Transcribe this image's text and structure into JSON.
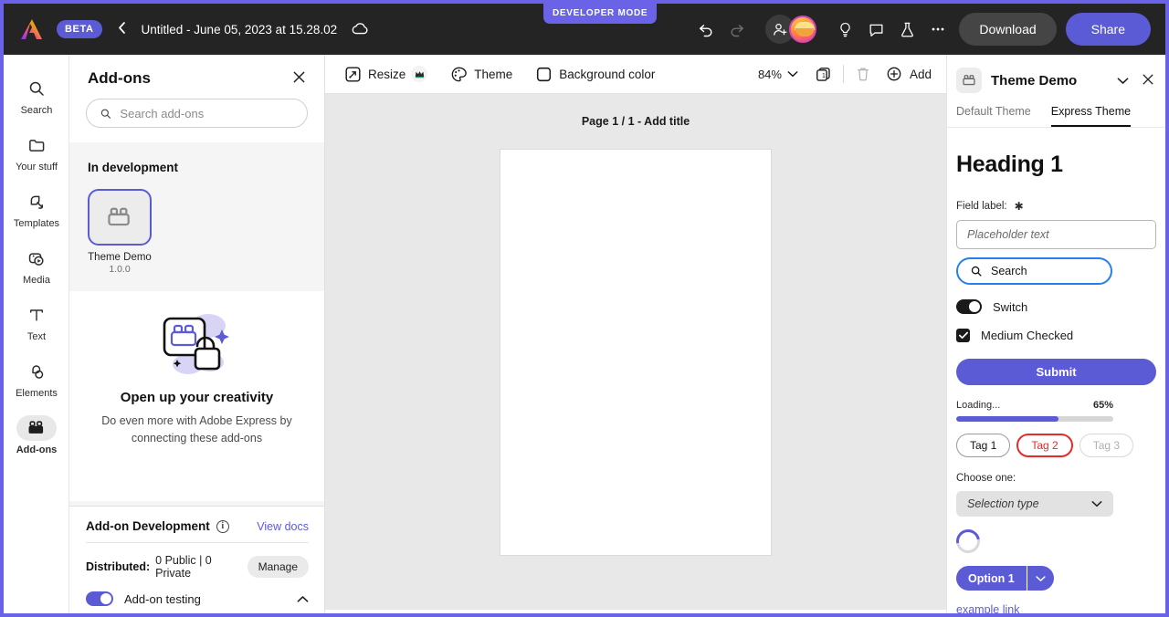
{
  "topbar": {
    "beta_badge": "BETA",
    "back_icon": "chevron-left-icon",
    "doc_title": "Untitled - June 05, 2023 at 15.28.02",
    "cloud_icon": "cloud-icon",
    "dev_mode_label": "DEVELOPER MODE",
    "undo_icon": "undo-icon",
    "redo_icon": "redo-icon",
    "invite_icon": "add-user-icon",
    "avatar_icon": "user-avatar",
    "ideas_icon": "lightbulb-icon",
    "comment_icon": "comment-icon",
    "experiments_icon": "flask-icon",
    "more_icon": "more-horizontal-icon",
    "download_label": "Download",
    "share_label": "Share"
  },
  "rail": {
    "items": [
      {
        "label": "Search",
        "icon": "search-icon",
        "active": false
      },
      {
        "label": "Your stuff",
        "icon": "folder-icon",
        "active": false
      },
      {
        "label": "Templates",
        "icon": "templates-icon",
        "active": false
      },
      {
        "label": "Media",
        "icon": "media-icon",
        "active": false
      },
      {
        "label": "Text",
        "icon": "text-icon",
        "active": false
      },
      {
        "label": "Elements",
        "icon": "elements-icon",
        "active": false
      },
      {
        "label": "Add-ons",
        "icon": "addons-icon",
        "active": true
      }
    ]
  },
  "panel": {
    "title": "Add-ons",
    "close_icon": "close-icon",
    "search_placeholder": "Search add-ons",
    "search_value": "",
    "search_icon": "search-icon",
    "in_development_title": "In development",
    "addon": {
      "name": "Theme Demo",
      "version": "1.0.0",
      "icon": "addons-icon"
    },
    "empty_state": {
      "illustration": "addon-unlock-illustration",
      "title": "Open up your creativity",
      "subtitle": "Do even more with Adobe Express by connecting these add-ons"
    },
    "development": {
      "heading": "Add-on Development",
      "info_icon": "info-icon",
      "view_docs": "View docs",
      "distributed_label": "Distributed:",
      "distributed_value": "0 Public | 0 Private",
      "manage_label": "Manage",
      "testing_label": "Add-on testing",
      "testing_on": true,
      "collapse_icon": "chevron-up-icon"
    }
  },
  "canvas": {
    "toolbar": {
      "resize_label": "Resize",
      "resize_icon": "resize-icon",
      "premium_icon": "crown-icon",
      "theme_label": "Theme",
      "theme_icon": "palette-icon",
      "background_label": "Background color",
      "background_icon": "square-icon",
      "zoom_value": "84%",
      "zoom_chevron": "chevron-down-icon",
      "pages_icon": "pages-icon",
      "delete_icon": "trash-icon",
      "add_label": "Add",
      "add_icon": "plus-circle-icon"
    },
    "page_label": "Page 1 / 1 - Add title"
  },
  "addon_panel": {
    "icon": "addons-icon",
    "title": "Theme Demo",
    "chevron_icon": "chevron-down-icon",
    "close_icon": "close-icon",
    "tabs": [
      {
        "label": "Default Theme",
        "active": false
      },
      {
        "label": "Express Theme",
        "active": true
      }
    ],
    "heading": "Heading 1",
    "field_label": "Field label:",
    "required_mark": "✱",
    "text_placeholder": "Placeholder text",
    "text_value": "",
    "search_label": "Search",
    "search_icon": "search-icon",
    "switch_label": "Switch",
    "switch_on": true,
    "checkbox_label": "Medium Checked",
    "checkbox_checked": true,
    "check_icon": "checkmark-icon",
    "submit_label": "Submit",
    "loading_label": "Loading...",
    "loading_percent": "65%",
    "progress_value": 65,
    "tags": [
      {
        "label": "Tag 1",
        "state": "default"
      },
      {
        "label": "Tag 2",
        "state": "error"
      },
      {
        "label": "Tag 3",
        "state": "disabled"
      }
    ],
    "choose_label": "Choose one:",
    "select_value": "Selection type",
    "select_chevron": "chevron-down-icon",
    "spinner_icon": "loading-spinner",
    "split_button_label": "Option 1",
    "split_button_chevron": "chevron-down-icon",
    "link_label": "example link"
  },
  "colors": {
    "accent": "#5b5bd6",
    "dev_mode": "#6a63e8",
    "focus_blue": "#2680eb",
    "error_red": "#e32b2b",
    "topbar_bg": "#242424"
  }
}
